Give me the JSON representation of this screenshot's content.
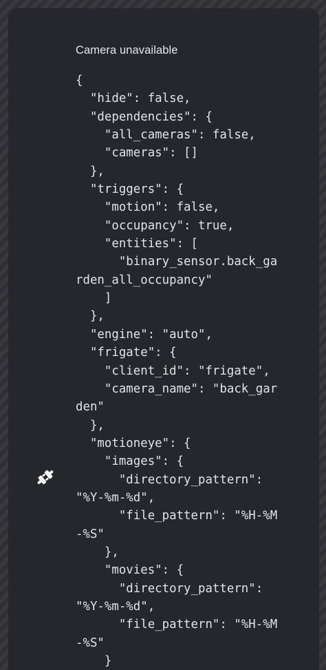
{
  "card": {
    "title": "Camera unavailable",
    "status_icon": "disconnected-plug-icon",
    "config_text": "{\n  \"hide\": false,\n  \"dependencies\": {\n    \"all_cameras\": false,\n    \"cameras\": []\n  },\n  \"triggers\": {\n    \"motion\": false,\n    \"occupancy\": true,\n    \"entities\": [\n      \"binary_sensor.back_ga\nrden_all_occupancy\"\n    ]\n  },\n  \"engine\": \"auto\",\n  \"frigate\": {\n    \"client_id\": \"frigate\",\n    \"camera_name\": \"back_gar\nden\"\n  },\n  \"motioneye\": {\n    \"images\": {\n      \"directory_pattern\":\n\"%Y-%m-%d\",\n      \"file_pattern\": \"%H-%M\n-%S\"\n    },\n    \"movies\": {\n      \"directory_pattern\":\n\"%Y-%m-%d\",\n      \"file_pattern\": \"%H-%M\n-%S\"\n    }"
  },
  "colors": {
    "card_background": "#26272d",
    "text": "#e6e6ea",
    "icon": "#ffffff"
  }
}
